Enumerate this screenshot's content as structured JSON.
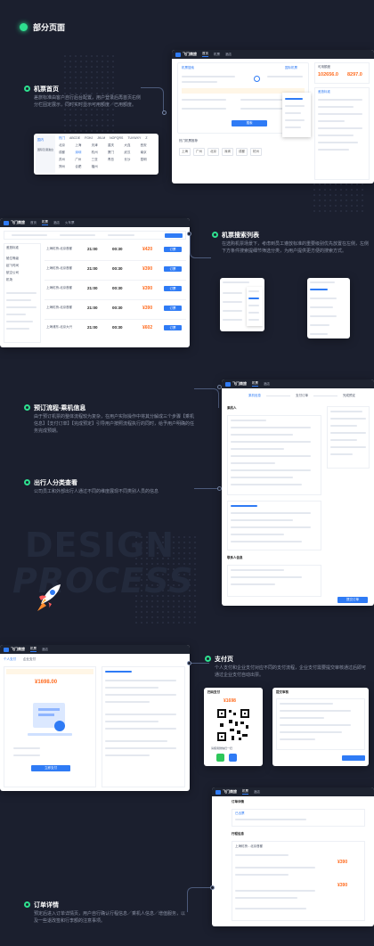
{
  "page": {
    "header_title": "部分页面"
  },
  "sections": {
    "home": {
      "title": "机票首页",
      "desc": "差旅标准由客户自行后台配置，用户登录后再首页右侧分栏固定展示，同时实时显示可用额度／已用额度。"
    },
    "search": {
      "title": "机票搜索列表",
      "desc": "在选购机票场景下，考虑到员工遵放标准的重要级别优先放置在左侧，左侧下方条件搜索提细节筛选分类，为用户提供更方便的搜索方式。"
    },
    "booking": {
      "title": "预订流程-乘机信息",
      "desc": "由于预订机票的整体流程较为复杂，在用户实际操作中将其分解成三个步骤【乘机信息】【支付订单】【完成预定】引导用户按照流程执行的同时，给予用户明确的任务完成预期。"
    },
    "travelers": {
      "title": "出行人分类查看",
      "desc": "公司员工和外部出行人通过不同的维度展现不同类别人员的信息"
    },
    "payment": {
      "title": "支付页",
      "desc": "个人支付和企业支付对应不同的支付流程，企业支付需要提交审核通过后即可通过企业支付自动出票。"
    },
    "order": {
      "title": "订单详情",
      "desc": "预定后进入订单详情页，用户自行确认行程信息／乘机人信息／增值服务，以及一些退改签和行李额的注意事项。"
    }
  },
  "background": {
    "word1": "DESIGN",
    "word2": "PROCESS"
  },
  "app": {
    "brand": "飞门商旅",
    "nav": [
      "首页",
      "机票",
      "酒店",
      "火车票",
      "差旅"
    ],
    "home_card": {
      "tab_domestic": "机票搜索",
      "tab_intl": "国际机票",
      "quota_available": "102656.0",
      "quota_used": "8297.0",
      "quota_label": "可用额度",
      "search_btn": "搜索",
      "trip_title": "差旅标准",
      "hot_title": "热门机票推荐",
      "hot_cities": [
        "上海",
        "广州",
        "北京",
        "深圳",
        "成都",
        "杭州"
      ]
    },
    "city_picker": {
      "tabs": [
        "热门",
        "ABCDE",
        "FGHJ",
        "JKLM",
        "NOPQRS",
        "TUVWXY",
        "Z"
      ],
      "side": [
        "国内",
        "国际及港澳台"
      ],
      "cities": [
        "北京",
        "上海",
        "天津",
        "重庆",
        "大连",
        "西安",
        "成都",
        "深圳",
        "杭州",
        "厦门",
        "武汉",
        "南京",
        "苏州",
        "广州",
        "三亚",
        "青岛",
        "长沙",
        "昆明",
        "郑州",
        "合肥",
        "福州"
      ]
    },
    "search_card": {
      "filter_title": "差旅标准",
      "filters": [
        "舱位等级",
        "起飞时间",
        "航空公司",
        "机场"
      ],
      "rows": [
        {
          "route": "上海虹桥-北京首都",
          "time": "21:00",
          "arr": "00:30",
          "price": "¥420"
        },
        {
          "route": "上海虹桥-北京首都",
          "time": "21:00",
          "arr": "00:30",
          "price": "¥390"
        },
        {
          "route": "上海虹桥-北京首都",
          "time": "21:00",
          "arr": "00:30",
          "price": "¥390"
        },
        {
          "route": "上海虹桥-北京首都",
          "time": "21:00",
          "arr": "00:30",
          "price": "¥390"
        },
        {
          "route": "上海浦东-北京大兴",
          "time": "21:00",
          "arr": "00:30",
          "price": "¥602"
        }
      ],
      "book_btn": "订票"
    },
    "booking_card": {
      "steps": [
        "乘机信息",
        "支付订单",
        "完成预定"
      ],
      "submit": "提交订单",
      "passenger_title": "乘机人",
      "contact_title": "联系人信息"
    },
    "payment_card": {
      "tabs": [
        "个人支付",
        "企业支付"
      ],
      "amount": "¥1698.00",
      "pay_btn": "立即支付",
      "qr_title": "扫码支付",
      "qr_amount": "¥1698",
      "qr_caption": "请使用微信扫一扫",
      "dialog_title": "提交审核"
    },
    "order_card": {
      "title": "订单详情",
      "status": "已出票",
      "itinerary": "行程信息",
      "route": "上海虹桥 - 北京首都",
      "price": "¥390",
      "price2": "¥390"
    }
  },
  "colors": {
    "accent": "#2ee08f",
    "brand": "#2f7bf5",
    "price": "#ff6b1e",
    "bg": "#1b1f2e"
  }
}
